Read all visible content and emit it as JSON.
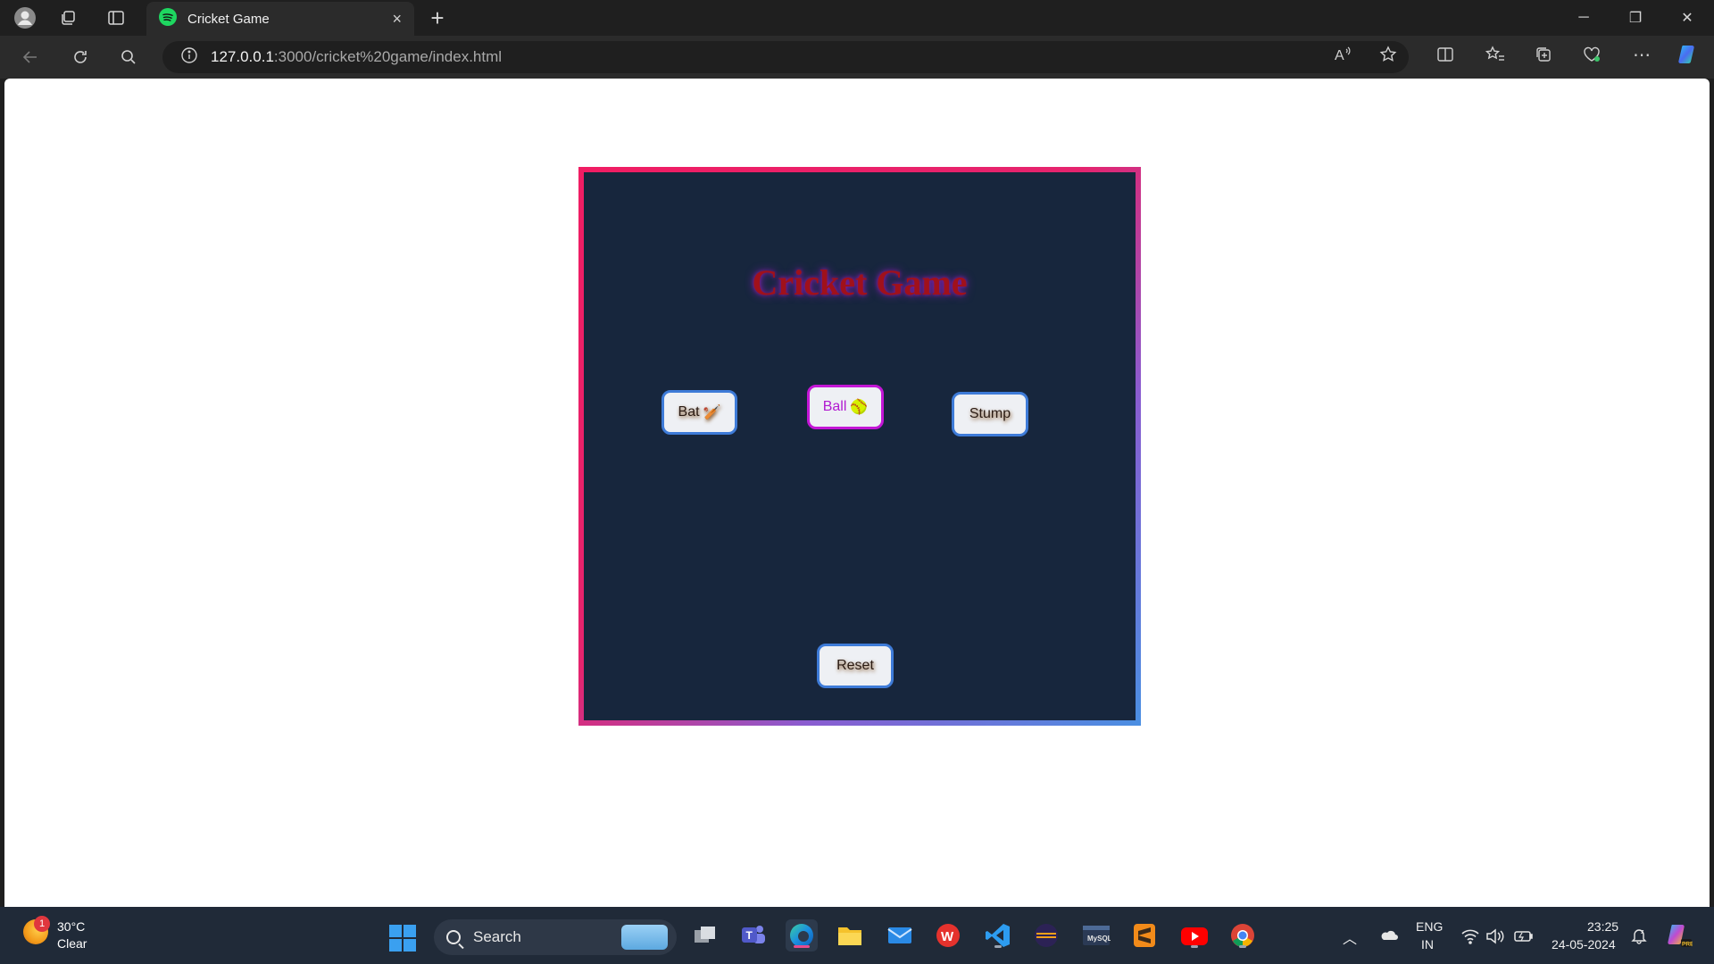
{
  "browser": {
    "tab_title": "Cricket Game",
    "tab_close": "×",
    "new_tab": "+",
    "url_host": "127.0.0.1",
    "url_path": ":3000/cricket%20game/index.html",
    "win_min": "─",
    "win_max": "❐",
    "win_close": "✕"
  },
  "game": {
    "title": "Cricket Game",
    "bat_label": "Bat",
    "bat_emoji": "🏏",
    "ball_label": "Ball",
    "ball_emoji": "🥎",
    "stump_label": "Stump",
    "reset_label": "Reset"
  },
  "taskbar": {
    "weather_badge": "1",
    "weather_temp": "30°C",
    "weather_condition": "Clear",
    "search_label": "Search",
    "lang_top": "ENG",
    "lang_bottom": "IN",
    "time": "23:25",
    "date": "24-05-2024"
  }
}
